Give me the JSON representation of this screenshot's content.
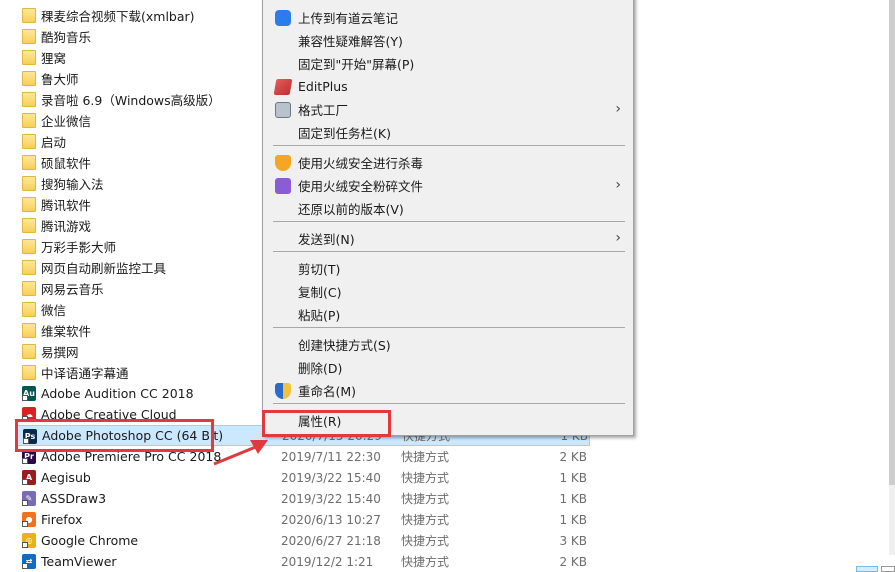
{
  "file_list": {
    "folders": [
      "稞麦综合视频下载(xmlbar)",
      "酷狗音乐",
      "狸窝",
      "鲁大师",
      "录音啦 6.9（Windows高级版）",
      "企业微信",
      "启动",
      "硕鼠软件",
      "搜狗输入法",
      "腾讯软件",
      "腾讯游戏",
      "万彩手影大师",
      "网页自动刷新监控工具",
      "网易云音乐",
      "微信",
      "维棠软件",
      "易撰网",
      "中译语通字幕通"
    ],
    "shortcuts": [
      {
        "name": "Adobe Audition CC 2018",
        "date": "",
        "type": "",
        "size": "",
        "icon": "adobe-audition-icon",
        "color": "#00584f",
        "glyph": "Au"
      },
      {
        "name": "Adobe Creative Cloud",
        "date": "",
        "type": "",
        "size": "",
        "icon": "creative-cloud-icon",
        "color": "#d92323",
        "glyph": "☁"
      },
      {
        "name": "Adobe Photoshop CC (64 Bit)",
        "date": "2020/7/15 20:29",
        "type": "快捷方式",
        "size": "1 KB",
        "icon": "photoshop-icon",
        "color": "#0a2a4a",
        "glyph": "Ps",
        "selected": true
      },
      {
        "name": "Adobe Premiere Pro CC 2018",
        "date": "2019/7/11 22:30",
        "type": "快捷方式",
        "size": "2 KB",
        "icon": "premiere-icon",
        "color": "#2a0845",
        "glyph": "Pr"
      },
      {
        "name": "Aegisub",
        "date": "2019/3/22 15:40",
        "type": "快捷方式",
        "size": "1 KB",
        "icon": "aegisub-icon",
        "color": "#9b1c1c",
        "glyph": "A"
      },
      {
        "name": "ASSDraw3",
        "date": "2019/3/22 15:40",
        "type": "快捷方式",
        "size": "1 KB",
        "icon": "assdraw-icon",
        "color": "#7a6bb5",
        "glyph": "✎"
      },
      {
        "name": "Firefox",
        "date": "2020/6/13 10:27",
        "type": "快捷方式",
        "size": "1 KB",
        "icon": "firefox-icon",
        "color": "#f2711c",
        "glyph": "●"
      },
      {
        "name": "Google Chrome",
        "date": "2020/6/27 21:18",
        "type": "快捷方式",
        "size": "3 KB",
        "icon": "chrome-icon",
        "color": "#e8b21b",
        "glyph": "◎"
      },
      {
        "name": "TeamViewer",
        "date": "2019/12/2 1:21",
        "type": "快捷方式",
        "size": "2 KB",
        "icon": "teamviewer-icon",
        "color": "#0e6cc4",
        "glyph": "⇄"
      }
    ]
  },
  "context_menu": {
    "items": [
      {
        "label": "上传到有道云笔记",
        "icon": "youdao-note-icon",
        "submenu": false
      },
      {
        "label": "兼容性疑难解答(Y)",
        "icon": "",
        "submenu": false
      },
      {
        "label": "固定到\"开始\"屏幕(P)",
        "icon": "",
        "submenu": false
      },
      {
        "label": "EditPlus",
        "icon": "editplus-icon",
        "submenu": false
      },
      {
        "label": "格式工厂",
        "icon": "format-factory-icon",
        "submenu": true
      },
      {
        "label": "固定到任务栏(K)",
        "icon": "",
        "submenu": false
      },
      {
        "label": "使用火绒安全进行杀毒",
        "icon": "huorong-antivirus-icon",
        "submenu": false
      },
      {
        "label": "使用火绒安全粉碎文件",
        "icon": "huorong-shredder-icon",
        "submenu": true
      },
      {
        "label": "还原以前的版本(V)",
        "icon": "",
        "submenu": false
      },
      {
        "label": "发送到(N)",
        "icon": "",
        "submenu": true
      },
      {
        "label": "剪切(T)",
        "icon": "",
        "submenu": false
      },
      {
        "label": "复制(C)",
        "icon": "",
        "submenu": false
      },
      {
        "label": "粘贴(P)",
        "icon": "",
        "submenu": false
      },
      {
        "label": "创建快捷方式(S)",
        "icon": "",
        "submenu": false
      },
      {
        "label": "删除(D)",
        "icon": "",
        "submenu": false
      },
      {
        "label": "重命名(M)",
        "icon": "uac-shield-icon",
        "submenu": false
      },
      {
        "label": "属性(R)",
        "icon": "",
        "submenu": false
      }
    ],
    "submenu_arrow": "›"
  },
  "annotations": {
    "highlight_color": "#e0393e"
  }
}
